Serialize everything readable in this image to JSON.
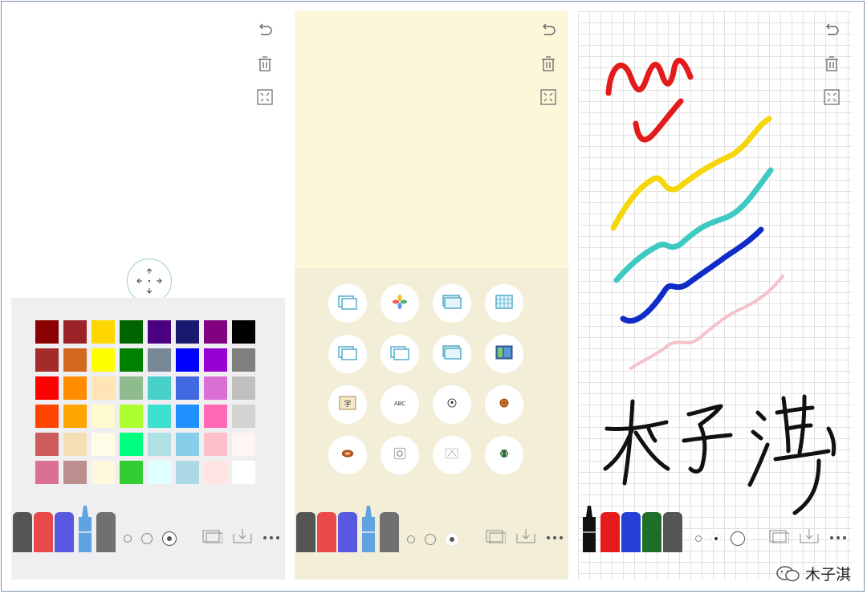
{
  "panel1": {
    "background": "#ffffff",
    "palette": [
      "#8b0000",
      "#9b2226",
      "#ffd700",
      "#006400",
      "#4b0082",
      "#191970",
      "#800080",
      "#000000",
      "#a52a2a",
      "#d2691e",
      "#ffff00",
      "#008000",
      "#778899",
      "#0000ff",
      "#9400d3",
      "#808080",
      "#ff0000",
      "#ff8c00",
      "#ffe4b5",
      "#8fbc8f",
      "#48d1cc",
      "#4169e1",
      "#da70d6",
      "#c0c0c0",
      "#ff4500",
      "#ffa500",
      "#fffacd",
      "#adff2f",
      "#40e0d0",
      "#1e90ff",
      "#ff69b4",
      "#d3d3d3",
      "#cd5c5c",
      "#f5deb3",
      "#fffde8",
      "#00ff7f",
      "#b0e0e6",
      "#87ceeb",
      "#ffc0cb",
      "#fff5f5",
      "#db7093",
      "#bc8f8f",
      "#fff8dc",
      "#32cd32",
      "#e0ffff",
      "#add8e6",
      "#ffe4e1",
      "#ffffff"
    ],
    "pens": [
      "#555555",
      "#e84a4a",
      "#5858e0",
      "#5fa3e0",
      "#707070"
    ]
  },
  "panel2": {
    "background": "#fdf7d9",
    "selector_background": "#f3eed7",
    "buttons": [
      {
        "icon": "frame-icon"
      },
      {
        "icon": "photos-icon"
      },
      {
        "icon": "stack-icon"
      },
      {
        "icon": "grid-paper-icon"
      },
      {
        "icon": "frame-icon"
      },
      {
        "icon": "frame-icon"
      },
      {
        "icon": "stack-icon"
      },
      {
        "icon": "color-card-icon"
      },
      {
        "icon": "character-card-icon",
        "label": "字"
      },
      {
        "icon": "abc-card-icon",
        "label": "ABC"
      },
      {
        "icon": "soccer-ball-icon"
      },
      {
        "icon": "basketball-icon"
      },
      {
        "icon": "football-icon"
      },
      {
        "icon": "volleyball-icon"
      },
      {
        "icon": "court-icon"
      },
      {
        "icon": "tennis-ball-icon"
      }
    ],
    "pens": [
      "#555555",
      "#e84a4a",
      "#5858e0",
      "#5fa3e0",
      "#707070"
    ]
  },
  "panel3": {
    "background": "#ffffff",
    "strokes": [
      "#e31b1b",
      "#f5d60a",
      "#3ec9c2",
      "#0f2cc9",
      "#f4c2cb",
      "#111111"
    ],
    "pens": [
      "#111111",
      "#e31b1b",
      "#2440d6",
      "#1f6e2a",
      "#555555"
    ]
  },
  "watermark": {
    "text": "木子淇"
  }
}
